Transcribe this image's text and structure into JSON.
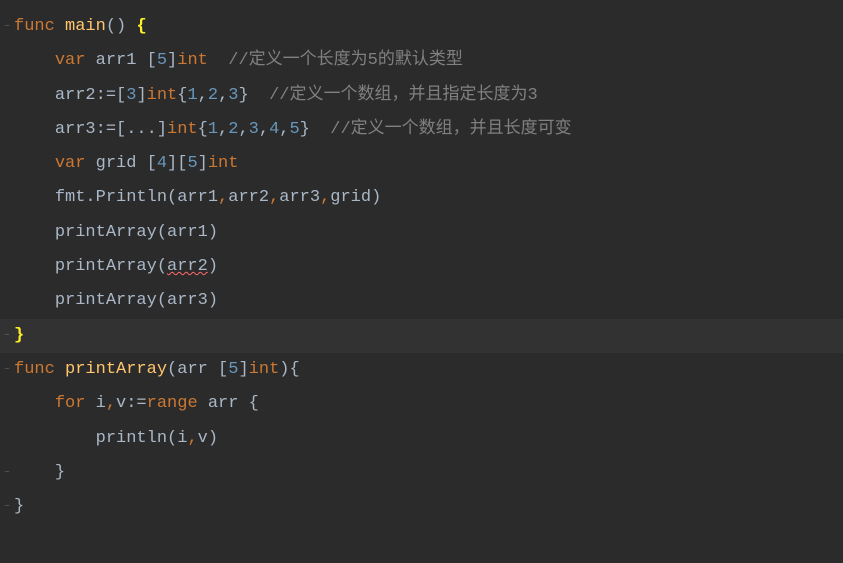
{
  "code": {
    "lines": [
      {
        "indent": 0,
        "tokens": [
          {
            "text": "func ",
            "class": "kw"
          },
          {
            "text": "main",
            "class": "func-name"
          },
          {
            "text": "() ",
            "class": "punct"
          },
          {
            "text": "{",
            "class": "bracket-match"
          }
        ]
      },
      {
        "indent": 1,
        "tokens": [
          {
            "text": "var ",
            "class": "kw"
          },
          {
            "text": "arr1 [",
            "class": "ident"
          },
          {
            "text": "5",
            "class": "num"
          },
          {
            "text": "]",
            "class": "punct"
          },
          {
            "text": "int",
            "class": "type"
          },
          {
            "text": "  //定义一个长度为5的默认类型",
            "class": "comment"
          }
        ]
      },
      {
        "indent": 1,
        "tokens": [
          {
            "text": "arr2:=[",
            "class": "ident"
          },
          {
            "text": "3",
            "class": "num"
          },
          {
            "text": "]",
            "class": "punct"
          },
          {
            "text": "int",
            "class": "type"
          },
          {
            "text": "{",
            "class": "punct"
          },
          {
            "text": "1",
            "class": "num"
          },
          {
            "text": ",",
            "class": "punct"
          },
          {
            "text": "2",
            "class": "num"
          },
          {
            "text": ",",
            "class": "punct"
          },
          {
            "text": "3",
            "class": "num"
          },
          {
            "text": "}  ",
            "class": "punct"
          },
          {
            "text": "//定义一个数组，并且指定长度为3",
            "class": "comment"
          }
        ]
      },
      {
        "indent": 1,
        "tokens": [
          {
            "text": "arr3:=[...]",
            "class": "ident"
          },
          {
            "text": "int",
            "class": "type"
          },
          {
            "text": "{",
            "class": "punct"
          },
          {
            "text": "1",
            "class": "num"
          },
          {
            "text": ",",
            "class": "punct"
          },
          {
            "text": "2",
            "class": "num"
          },
          {
            "text": ",",
            "class": "punct"
          },
          {
            "text": "3",
            "class": "num"
          },
          {
            "text": ",",
            "class": "punct"
          },
          {
            "text": "4",
            "class": "num"
          },
          {
            "text": ",",
            "class": "punct"
          },
          {
            "text": "5",
            "class": "num"
          },
          {
            "text": "}  ",
            "class": "punct"
          },
          {
            "text": "//定义一个数组，并且长度可变",
            "class": "comment"
          }
        ]
      },
      {
        "indent": 1,
        "tokens": [
          {
            "text": "var ",
            "class": "kw"
          },
          {
            "text": "grid [",
            "class": "ident"
          },
          {
            "text": "4",
            "class": "num"
          },
          {
            "text": "][",
            "class": "punct"
          },
          {
            "text": "5",
            "class": "num"
          },
          {
            "text": "]",
            "class": "punct"
          },
          {
            "text": "int",
            "class": "type"
          }
        ]
      },
      {
        "indent": 1,
        "tokens": [
          {
            "text": "fmt.Println(arr1",
            "class": "ident"
          },
          {
            "text": ",",
            "class": "kw"
          },
          {
            "text": "arr2",
            "class": "ident"
          },
          {
            "text": ",",
            "class": "kw"
          },
          {
            "text": "arr3",
            "class": "ident"
          },
          {
            "text": ",",
            "class": "kw"
          },
          {
            "text": "grid)",
            "class": "ident"
          }
        ]
      },
      {
        "indent": 1,
        "tokens": [
          {
            "text": "printArray(arr1)",
            "class": "ident"
          }
        ]
      },
      {
        "indent": 1,
        "tokens": [
          {
            "text": "printArray(",
            "class": "ident"
          },
          {
            "text": "arr2",
            "class": "ident error-underline"
          },
          {
            "text": ")",
            "class": "ident"
          }
        ]
      },
      {
        "indent": 1,
        "tokens": [
          {
            "text": "printArray(arr3)",
            "class": "ident"
          }
        ]
      },
      {
        "indent": 0,
        "highlighted": true,
        "tokens": [
          {
            "text": "}",
            "class": "bracket-match"
          }
        ]
      },
      {
        "indent": 0,
        "tokens": []
      },
      {
        "indent": 0,
        "tokens": [
          {
            "text": "func ",
            "class": "kw"
          },
          {
            "text": "printArray",
            "class": "func-name"
          },
          {
            "text": "(arr [",
            "class": "ident"
          },
          {
            "text": "5",
            "class": "num"
          },
          {
            "text": "]",
            "class": "punct"
          },
          {
            "text": "int",
            "class": "type"
          },
          {
            "text": "){",
            "class": "punct"
          }
        ]
      },
      {
        "indent": 1,
        "tokens": [
          {
            "text": "for ",
            "class": "kw"
          },
          {
            "text": "i",
            "class": "ident"
          },
          {
            "text": ",",
            "class": "kw"
          },
          {
            "text": "v:=",
            "class": "ident"
          },
          {
            "text": "range ",
            "class": "kw"
          },
          {
            "text": "arr {",
            "class": "ident"
          }
        ]
      },
      {
        "indent": 2,
        "tokens": [
          {
            "text": "println(i",
            "class": "ident"
          },
          {
            "text": ",",
            "class": "kw"
          },
          {
            "text": "v)",
            "class": "ident"
          }
        ]
      },
      {
        "indent": 1,
        "tokens": [
          {
            "text": "}",
            "class": "punct"
          }
        ]
      },
      {
        "indent": 0,
        "tokens": [
          {
            "text": "}",
            "class": "punct"
          }
        ]
      }
    ]
  },
  "indent_string": "    "
}
